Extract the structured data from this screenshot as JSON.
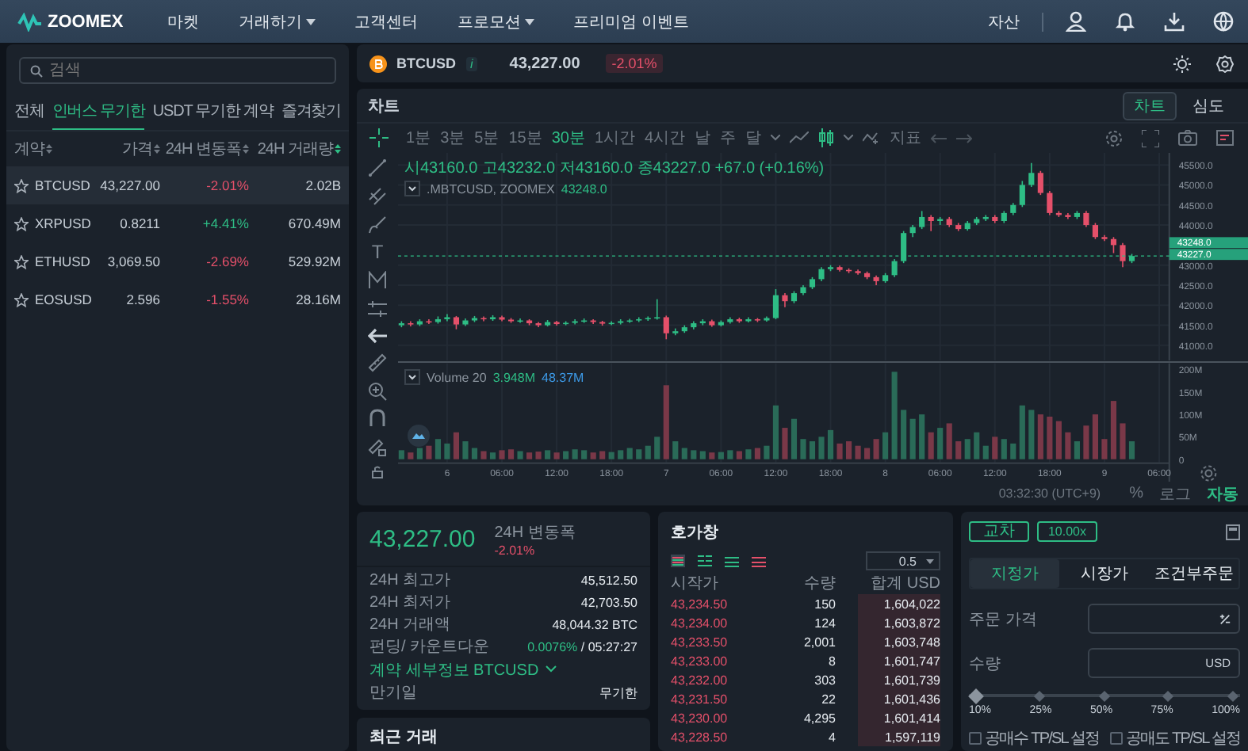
{
  "nav": {
    "logo": "ZOOMEX",
    "menu": [
      {
        "label": "마켓",
        "dropdown": false
      },
      {
        "label": "거래하기",
        "dropdown": true
      },
      {
        "label": "고객센터",
        "dropdown": false
      },
      {
        "label": "프로모션",
        "dropdown": true
      },
      {
        "label": "프리미엄 이벤트",
        "dropdown": false
      }
    ],
    "assets": "자산"
  },
  "markets": {
    "search": {
      "placeholder": "검색"
    },
    "tabs": [
      {
        "label": "전체",
        "selected": false
      },
      {
        "label": "인버스 무기한",
        "selected": true
      },
      {
        "label": "USDT 무기한 계약",
        "selected": false
      },
      {
        "label": "즐겨찾기",
        "selected": false
      }
    ],
    "columns": [
      "계약",
      "가격",
      "24H 변동폭",
      "24H 거래량"
    ],
    "rows": [
      {
        "symbol": "BTCUSD",
        "price": "43,227.00",
        "change": "-2.01%",
        "color": "#e5506a",
        "volume": "2.02B",
        "selected": true
      },
      {
        "symbol": "XRPUSD",
        "price": "0.8211",
        "change": "+4.41%",
        "color": "#2ebd85",
        "volume": "670.49M",
        "selected": false
      },
      {
        "symbol": "ETHUSD",
        "price": "3,069.50",
        "change": "-2.69%",
        "color": "#e5506a",
        "volume": "529.92M",
        "selected": false
      },
      {
        "symbol": "EOSUSD",
        "price": "2.596",
        "change": "-1.55%",
        "color": "#e5506a",
        "volume": "28.16M",
        "selected": false
      }
    ]
  },
  "ticker": {
    "symbol": "BTCUSD",
    "info": "i",
    "price": "43,227.00",
    "change": "-2.01%"
  },
  "chart": {
    "title": "차트",
    "views": [
      {
        "label": "차트",
        "selected": true
      },
      {
        "label": "심도",
        "selected": false
      }
    ],
    "intervals": [
      {
        "label": "1분",
        "selected": false
      },
      {
        "label": "3분",
        "selected": false
      },
      {
        "label": "5분",
        "selected": false
      },
      {
        "label": "15분",
        "selected": false
      },
      {
        "label": "30분",
        "selected": true
      },
      {
        "label": "1시간",
        "selected": false
      },
      {
        "label": "4시간",
        "selected": false
      },
      {
        "label": "날",
        "selected": false
      },
      {
        "label": "주",
        "selected": false
      },
      {
        "label": "달",
        "selected": false
      }
    ],
    "indicators": "지표",
    "text_tool": "T",
    "ohlc": "시43160.0 고43232.0 저43160.0 종43227.0 +67.0 (+0.16%)",
    "index_name": ".MBTCUSD, ZOOMEX",
    "index_value": "43248.0",
    "index_tag": "43248.0",
    "price_chart": {
      "chart_data": {
        "type": "candlestick",
        "ylim": [
          40700,
          45800
        ],
        "grid": true,
        "ref_lines": [
          {
            "axis": "y",
            "value": 43227,
            "label": "43227.0",
            "color": "#2ebd85"
          }
        ],
        "ohlc": [
          [
            41500,
            41600,
            41450,
            41550
          ],
          [
            41550,
            41600,
            41470,
            41520
          ],
          [
            41520,
            41650,
            41480,
            41600
          ],
          [
            41600,
            41650,
            41530,
            41580
          ],
          [
            41580,
            41720,
            41540,
            41650
          ],
          [
            41650,
            41780,
            41600,
            41700
          ],
          [
            41700,
            41730,
            41400,
            41520
          ],
          [
            41520,
            41670,
            41480,
            41620
          ],
          [
            41620,
            41730,
            41580,
            41680
          ],
          [
            41680,
            41720,
            41600,
            41650
          ],
          [
            41650,
            41750,
            41610,
            41700
          ],
          [
            41700,
            41740,
            41600,
            41640
          ],
          [
            41640,
            41680,
            41560,
            41600
          ],
          [
            41600,
            41670,
            41560,
            41620
          ],
          [
            41620,
            41650,
            41500,
            41550
          ],
          [
            41550,
            41580,
            41450,
            41500
          ],
          [
            41500,
            41630,
            41470,
            41580
          ],
          [
            41580,
            41610,
            41490,
            41530
          ],
          [
            41530,
            41600,
            41500,
            41560
          ],
          [
            41560,
            41650,
            41520,
            41600
          ],
          [
            41600,
            41670,
            41560,
            41620
          ],
          [
            41620,
            41650,
            41530,
            41580
          ],
          [
            41580,
            41610,
            41490,
            41540
          ],
          [
            41540,
            41600,
            41500,
            41560
          ],
          [
            41560,
            41650,
            41520,
            41600
          ],
          [
            41600,
            41660,
            41560,
            41620
          ],
          [
            41620,
            41700,
            41580,
            41650
          ],
          [
            41650,
            41720,
            41610,
            41680
          ],
          [
            41680,
            42150,
            41640,
            41700
          ],
          [
            41700,
            41740,
            41150,
            41300
          ],
          [
            41300,
            41420,
            41250,
            41350
          ],
          [
            41350,
            41500,
            41310,
            41450
          ],
          [
            41450,
            41600,
            41400,
            41550
          ],
          [
            41550,
            41650,
            41500,
            41600
          ],
          [
            41600,
            41640,
            41460,
            41500
          ],
          [
            41500,
            41620,
            41470,
            41580
          ],
          [
            41580,
            41700,
            41540,
            41650
          ],
          [
            41650,
            41690,
            41560,
            41600
          ],
          [
            41600,
            41700,
            41570,
            41650
          ],
          [
            41650,
            41680,
            41580,
            41620
          ],
          [
            41620,
            41720,
            41590,
            41680
          ],
          [
            41680,
            42400,
            41650,
            42250
          ],
          [
            42250,
            42300,
            41950,
            42100
          ],
          [
            42100,
            42350,
            42050,
            42300
          ],
          [
            42300,
            42500,
            42250,
            42450
          ],
          [
            42450,
            42700,
            42400,
            42650
          ],
          [
            42650,
            42950,
            42600,
            42900
          ],
          [
            42900,
            43000,
            42850,
            42950
          ],
          [
            42950,
            42990,
            42840,
            42880
          ],
          [
            42880,
            42920,
            42800,
            42850
          ],
          [
            42850,
            42890,
            42760,
            42800
          ],
          [
            42800,
            42840,
            42650,
            42700
          ],
          [
            42700,
            42740,
            42500,
            42600
          ],
          [
            42600,
            42800,
            42560,
            42750
          ],
          [
            42750,
            43150,
            42700,
            43100
          ],
          [
            43100,
            43850,
            43050,
            43800
          ],
          [
            43800,
            44000,
            43700,
            43950
          ],
          [
            43950,
            44350,
            43900,
            44200
          ],
          [
            44200,
            44250,
            43850,
            44100
          ],
          [
            44100,
            44200,
            44000,
            44150
          ],
          [
            44150,
            44200,
            43950,
            44000
          ],
          [
            44000,
            44050,
            43850,
            43900
          ],
          [
            43900,
            44100,
            43860,
            44050
          ],
          [
            44050,
            44200,
            44000,
            44150
          ],
          [
            44150,
            44250,
            44100,
            44200
          ],
          [
            44200,
            44250,
            44050,
            44100
          ],
          [
            44100,
            44350,
            44050,
            44300
          ],
          [
            44300,
            44550,
            44250,
            44500
          ],
          [
            44500,
            45100,
            44450,
            45000
          ],
          [
            45000,
            45550,
            44950,
            45300
          ],
          [
            45300,
            45350,
            44750,
            44800
          ],
          [
            44800,
            44850,
            44250,
            44300
          ],
          [
            44300,
            44350,
            44200,
            44250
          ],
          [
            44250,
            44300,
            44150,
            44200
          ],
          [
            44200,
            44350,
            44150,
            44300
          ],
          [
            44300,
            44350,
            43950,
            44000
          ],
          [
            44000,
            44050,
            43650,
            43700
          ],
          [
            43700,
            43750,
            43600,
            43650
          ],
          [
            43650,
            43700,
            43300,
            43500
          ],
          [
            43500,
            43550,
            42950,
            43100
          ],
          [
            43100,
            43280,
            43050,
            43227
          ],
          null,
          null,
          null
        ],
        "yticks": [
          {
            "value": 45500,
            "label": "45500.0"
          },
          {
            "value": 45000,
            "label": "45000.0"
          },
          {
            "value": 44500,
            "label": "44500.0"
          },
          {
            "value": 44000,
            "label": "44000.0"
          },
          {
            "value": 43000,
            "label": "43000.0"
          },
          {
            "value": 42500,
            "label": "42500.0"
          },
          {
            "value": 42000,
            "label": "42000.0"
          },
          {
            "value": 41500,
            "label": "41500.0"
          },
          {
            "value": 41000,
            "label": "41000.0"
          }
        ]
      }
    },
    "volume_title": "Volume 20",
    "volume_value": "3.948M",
    "volume_ma": "48.37M",
    "volume_chart": {
      "chart_data": {
        "type": "bar",
        "ylim": [
          0,
          200
        ],
        "grid": true,
        "categories": [
          null,
          null,
          null,
          null,
          null,
          "6",
          null,
          null,
          null,
          null,
          null,
          "06:00",
          null,
          null,
          null,
          null,
          null,
          "12:00",
          null,
          null,
          null,
          null,
          null,
          "18:00",
          null,
          null,
          null,
          null,
          null,
          "7",
          null,
          null,
          null,
          null,
          null,
          "06:00",
          null,
          null,
          null,
          null,
          null,
          "12:00",
          null,
          null,
          null,
          null,
          null,
          "18:00",
          null,
          null,
          null,
          null,
          null,
          "8",
          null,
          null,
          null,
          null,
          null,
          "06:00",
          null,
          null,
          null,
          null,
          null,
          "12:00",
          null,
          null,
          null,
          null,
          null,
          "18:00",
          null,
          null,
          null,
          null,
          null,
          "9",
          null,
          null,
          null,
          null,
          null,
          "06:00"
        ],
        "values": [
          20,
          15,
          25,
          30,
          45,
          35,
          60,
          40,
          25,
          18,
          15,
          20,
          22,
          18,
          15,
          17,
          20,
          15,
          18,
          22,
          20,
          15,
          18,
          16,
          20,
          25,
          22,
          30,
          50,
          165,
          40,
          25,
          20,
          18,
          15,
          16,
          20,
          18,
          22,
          25,
          30,
          120,
          70,
          90,
          45,
          40,
          50,
          65,
          35,
          40,
          30,
          25,
          45,
          60,
          195,
          110,
          90,
          100,
          60,
          70,
          80,
          40,
          45,
          60,
          30,
          50,
          45,
          35,
          120,
          110,
          100,
          95,
          85,
          60,
          40,
          75,
          100,
          45,
          130,
          80,
          40,
          null,
          null,
          null
        ],
        "yticks": [
          {
            "value": 200,
            "label": "200M"
          },
          {
            "value": 150,
            "label": "150M"
          },
          {
            "value": 100,
            "label": "100M"
          },
          {
            "value": 50,
            "label": "50M"
          },
          {
            "value": 0,
            "label": "0"
          }
        ]
      }
    },
    "clock": "03:32:30 (UTC+9)",
    "scale_modes": [
      {
        "label": "%",
        "selected": false
      },
      {
        "label": "로그",
        "selected": false
      },
      {
        "label": "자동",
        "selected": true
      }
    ]
  },
  "stats": {
    "price": "43,227.00",
    "change_label": "24H 변동폭",
    "change": "-2.01%",
    "rows": [
      {
        "label": "24H 최고가",
        "value": "45,512.50"
      },
      {
        "label": "24H 최저가",
        "value": "42,703.50"
      },
      {
        "label": "24H 거래액",
        "value": "48,044.32 BTC"
      }
    ],
    "funding_label": "펀딩/ 카운트다운",
    "funding_rate": "0.0076%",
    "countdown": "/ 05:27:27",
    "details_link": "계약 세부정보 BTCUSD",
    "expiry_label": "만기일",
    "expiry_value": "무기한",
    "recent_trades": "최근 거래"
  },
  "order_book": {
    "title": "호가창",
    "step": "0.5",
    "columns": [
      "시작가",
      "수량",
      "합계 USD"
    ],
    "rows": [
      {
        "price": "43,234.50",
        "size": "150",
        "total": "1,604,022"
      },
      {
        "price": "43,234.00",
        "size": "124",
        "total": "1,603,872"
      },
      {
        "price": "43,233.50",
        "size": "2,001",
        "total": "1,603,748"
      },
      {
        "price": "43,233.00",
        "size": "8",
        "total": "1,601,747"
      },
      {
        "price": "43,232.00",
        "size": "303",
        "total": "1,601,739"
      },
      {
        "price": "43,231.50",
        "size": "22",
        "total": "1,601,436"
      },
      {
        "price": "43,230.00",
        "size": "4,295",
        "total": "1,601,414"
      },
      {
        "price": "43,228.50",
        "size": "4",
        "total": "1,597,119"
      }
    ]
  },
  "order_form": {
    "margin_mode": "교차",
    "leverage": "10.00x",
    "types": [
      {
        "label": "지정가",
        "selected": true
      },
      {
        "label": "시장가",
        "selected": false
      },
      {
        "label": "조건부주문",
        "selected": false
      }
    ],
    "price_label": "주문 가격",
    "qty_label": "수량",
    "qty_unit": "USD",
    "slider": {
      "level": 0,
      "marks": [
        "10%",
        "25%",
        "50%",
        "75%",
        "100%"
      ]
    },
    "options": [
      {
        "label": "공매수 TP/SL 설정",
        "checked": false
      },
      {
        "label": "공매도 TP/SL 설정",
        "checked": false
      }
    ]
  }
}
